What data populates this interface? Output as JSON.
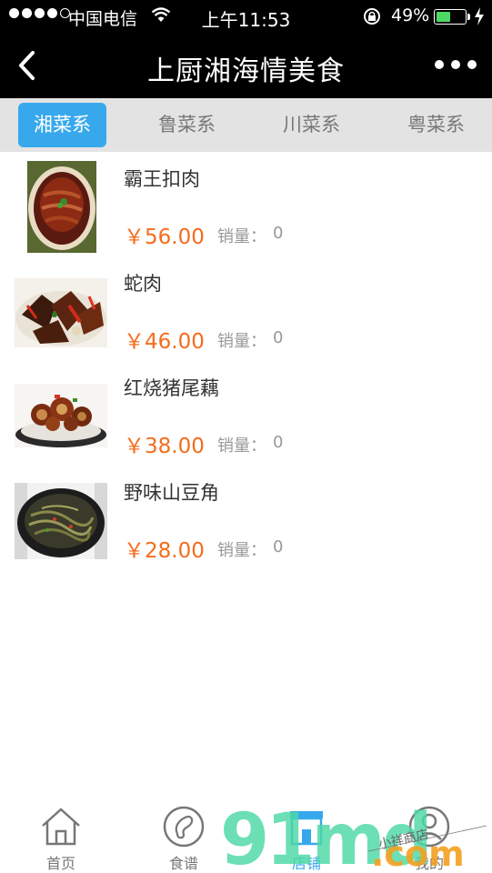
{
  "status_bar": {
    "carrier": "中国电信",
    "time": "上午11:53",
    "battery_percent": "49%",
    "battery_level": 0.49,
    "icons": [
      "signal-icon",
      "wifi-icon",
      "rotation-lock-icon",
      "battery-icon",
      "charging-icon"
    ]
  },
  "nav": {
    "title": "上厨湘海情美食",
    "back_icon": "chevron-left-icon",
    "more_icon": "more-dots-icon"
  },
  "tabs": [
    {
      "label": "湘菜系",
      "active": true
    },
    {
      "label": "鲁菜系",
      "active": false
    },
    {
      "label": "川菜系",
      "active": false
    },
    {
      "label": "粤菜系",
      "active": false
    }
  ],
  "products": [
    {
      "name": "霸王扣肉",
      "price": "￥56.00",
      "sales_label": "销量：",
      "sales_value": "0"
    },
    {
      "name": "蛇肉",
      "price": "￥46.00",
      "sales_label": "销量：",
      "sales_value": "0"
    },
    {
      "name": "红烧猪尾藕",
      "price": "￥38.00",
      "sales_label": "销量：",
      "sales_value": "0"
    },
    {
      "name": "野味山豆角",
      "price": "￥28.00",
      "sales_label": "销量：",
      "sales_value": "0"
    }
  ],
  "tabbar": [
    {
      "label": "首页",
      "icon": "home-icon"
    },
    {
      "label": "食谱",
      "icon": "recipe-icon"
    },
    {
      "label": "店铺",
      "icon": "shop-icon"
    },
    {
      "label": "我的",
      "icon": "profile-icon"
    }
  ],
  "watermark": {
    "text": "91md",
    "suffix": ".com",
    "small_text": "小祥商店"
  },
  "colors": {
    "accent": "#38a8ec",
    "price": "#f56c1c",
    "nav_bg": "#000000",
    "tabs_bg": "#e3e3e3"
  }
}
